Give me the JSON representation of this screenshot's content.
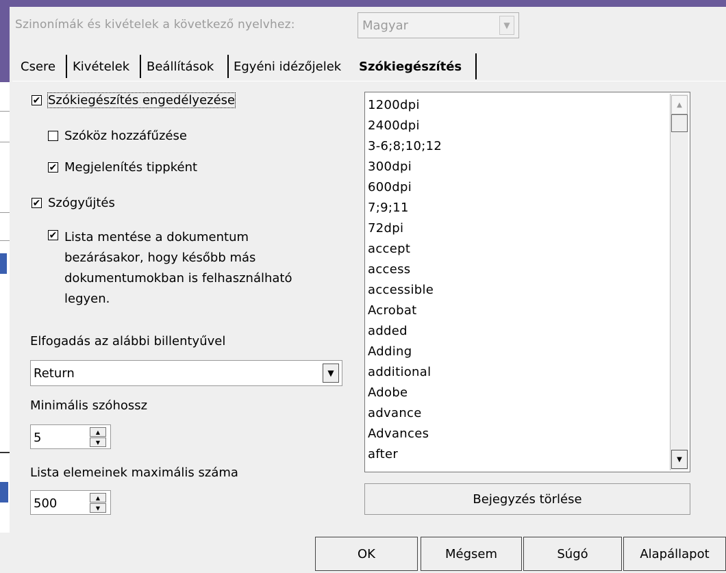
{
  "language_row": {
    "label": "Szinonímák és kivételek a következő nyelvhez:",
    "selected": "Magyar"
  },
  "tabs": [
    {
      "label": "Csere"
    },
    {
      "label": "Kivételek"
    },
    {
      "label": "Beállítások"
    },
    {
      "label": "Egyéni idézőjelek"
    },
    {
      "label": "Szókiegészítés",
      "active": true
    }
  ],
  "options": {
    "enable_word_completion": {
      "label": "Szókiegészítés engedélyezése",
      "checked": true
    },
    "append_space": {
      "label": "Szóköz hozzáfűzése",
      "checked": false
    },
    "show_as_tip": {
      "label": "Megjelenítés tippként",
      "checked": true
    },
    "collect_words": {
      "label": "Szógyűjtés",
      "checked": true
    },
    "save_list": {
      "checked": true,
      "lines": [
        "Lista mentése a dokumentum",
        "bezárásakor, hogy később más",
        "dokumentumokban is felhasználható",
        "legyen."
      ]
    }
  },
  "accept_key": {
    "label": "Elfogadás az alábbi billentyűvel",
    "value": "Return"
  },
  "min_word_length": {
    "label": "Minimális szóhossz",
    "value": "5"
  },
  "max_entries": {
    "label": "Lista elemeinek maximális száma",
    "value": "500"
  },
  "word_list": [
    "1200dpi",
    "2400dpi",
    "3-6;8;10;12",
    "300dpi",
    "600dpi",
    "7;9;11",
    "72dpi",
    "accept",
    "access",
    "accessible",
    "Acrobat",
    "added",
    "Adding",
    "additional",
    "Adobe",
    "advance",
    "Advances",
    "after"
  ],
  "delete_entry_button": "Bejegyzés törlése",
  "buttons": {
    "ok": "OK",
    "cancel": "Mégsem",
    "help": "Súgó",
    "reset": "Alapállapot"
  },
  "icons": {
    "checkbox_mark": "✔",
    "dropdown": "chevron-down-icon",
    "spin_up": "triangle-up-icon",
    "spin_down": "triangle-down-icon"
  }
}
